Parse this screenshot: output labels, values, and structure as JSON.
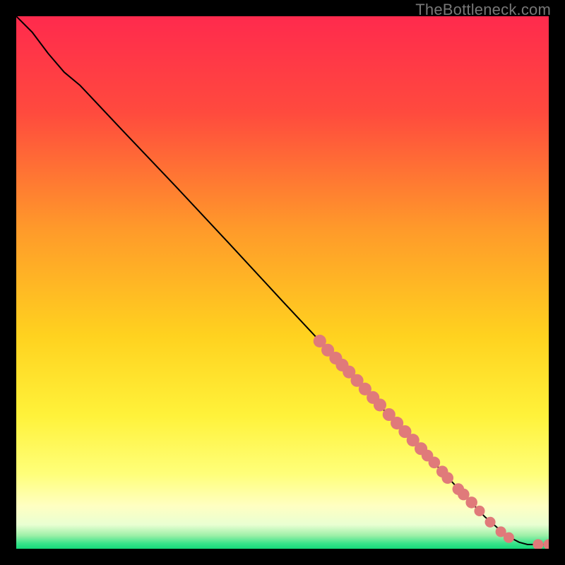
{
  "watermark": "TheBottleneck.com",
  "chart_data": {
    "type": "line",
    "title": "",
    "xlabel": "",
    "ylabel": "",
    "xlim": [
      0,
      100
    ],
    "ylim": [
      0,
      100
    ],
    "grid": false,
    "legend": false,
    "background_gradient_stops": [
      {
        "offset": 0,
        "color": "#ff2a4d"
      },
      {
        "offset": 0.18,
        "color": "#ff4a3e"
      },
      {
        "offset": 0.4,
        "color": "#ff9a2a"
      },
      {
        "offset": 0.6,
        "color": "#ffd21f"
      },
      {
        "offset": 0.75,
        "color": "#fff23a"
      },
      {
        "offset": 0.86,
        "color": "#ffff7a"
      },
      {
        "offset": 0.92,
        "color": "#ffffc2"
      },
      {
        "offset": 0.955,
        "color": "#e9ffd2"
      },
      {
        "offset": 0.975,
        "color": "#9ef0a8"
      },
      {
        "offset": 0.99,
        "color": "#39e38a"
      },
      {
        "offset": 1.0,
        "color": "#16d97a"
      }
    ],
    "series": [
      {
        "name": "curve",
        "type": "line",
        "color": "#000000",
        "width": 2,
        "points": [
          {
            "x": 0.0,
            "y": 100.0
          },
          {
            "x": 3.0,
            "y": 97.0
          },
          {
            "x": 6.0,
            "y": 93.0
          },
          {
            "x": 9.0,
            "y": 89.5
          },
          {
            "x": 12.0,
            "y": 87.0
          },
          {
            "x": 20.0,
            "y": 78.5
          },
          {
            "x": 30.0,
            "y": 68.0
          },
          {
            "x": 40.0,
            "y": 57.3
          },
          {
            "x": 50.0,
            "y": 46.5
          },
          {
            "x": 60.0,
            "y": 35.8
          },
          {
            "x": 70.0,
            "y": 25.0
          },
          {
            "x": 80.0,
            "y": 14.5
          },
          {
            "x": 88.0,
            "y": 6.0
          },
          {
            "x": 92.0,
            "y": 2.5
          },
          {
            "x": 94.5,
            "y": 1.2
          },
          {
            "x": 96.0,
            "y": 0.8
          },
          {
            "x": 98.0,
            "y": 0.8
          },
          {
            "x": 100.0,
            "y": 0.8
          }
        ]
      },
      {
        "name": "markers",
        "type": "scatter",
        "color": "#e07a7a",
        "points": [
          {
            "x": 57.0,
            "y": 39.0,
            "r": 1.2
          },
          {
            "x": 58.5,
            "y": 37.3,
            "r": 1.2
          },
          {
            "x": 60.0,
            "y": 35.8,
            "r": 1.2
          },
          {
            "x": 61.2,
            "y": 34.5,
            "r": 1.2
          },
          {
            "x": 62.5,
            "y": 33.2,
            "r": 1.2
          },
          {
            "x": 64.0,
            "y": 31.6,
            "r": 1.2
          },
          {
            "x": 65.5,
            "y": 30.0,
            "r": 1.2
          },
          {
            "x": 67.0,
            "y": 28.4,
            "r": 1.2
          },
          {
            "x": 68.3,
            "y": 27.0,
            "r": 1.2
          },
          {
            "x": 70.0,
            "y": 25.2,
            "r": 1.2
          },
          {
            "x": 71.5,
            "y": 23.6,
            "r": 1.2
          },
          {
            "x": 73.0,
            "y": 22.0,
            "r": 1.2
          },
          {
            "x": 74.5,
            "y": 20.4,
            "r": 1.2
          },
          {
            "x": 76.0,
            "y": 18.8,
            "r": 1.2
          },
          {
            "x": 77.2,
            "y": 17.5,
            "r": 1.1
          },
          {
            "x": 78.5,
            "y": 16.2,
            "r": 1.1
          },
          {
            "x": 80.0,
            "y": 14.5,
            "r": 1.1
          },
          {
            "x": 81.0,
            "y": 13.3,
            "r": 1.1
          },
          {
            "x": 83.0,
            "y": 11.2,
            "r": 1.1
          },
          {
            "x": 84.0,
            "y": 10.2,
            "r": 1.1
          },
          {
            "x": 85.5,
            "y": 8.7,
            "r": 1.1
          },
          {
            "x": 87.0,
            "y": 7.1,
            "r": 1.0
          },
          {
            "x": 89.0,
            "y": 5.0,
            "r": 1.0
          },
          {
            "x": 91.0,
            "y": 3.2,
            "r": 1.0
          },
          {
            "x": 92.5,
            "y": 2.1,
            "r": 1.0
          },
          {
            "x": 98.0,
            "y": 0.8,
            "r": 1.0
          },
          {
            "x": 100.0,
            "y": 0.8,
            "r": 1.0
          }
        ]
      }
    ]
  }
}
